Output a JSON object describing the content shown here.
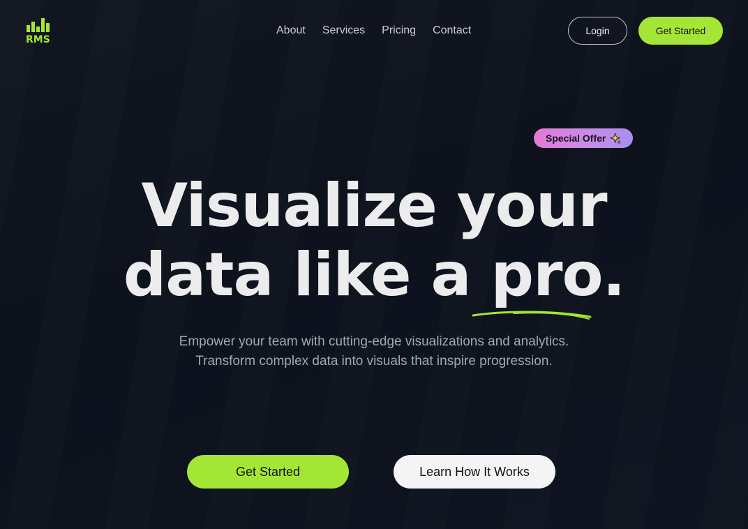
{
  "brand": {
    "logo_text": "RMS",
    "accent": "#a3e635"
  },
  "nav": {
    "items": [
      {
        "label": "About"
      },
      {
        "label": "Services"
      },
      {
        "label": "Pricing"
      },
      {
        "label": "Contact"
      }
    ]
  },
  "header": {
    "login_label": "Login",
    "get_started_label": "Get Started"
  },
  "badge": {
    "label": "Special Offer",
    "icon": "sparkle-icon",
    "gradient": [
      "#e37ad6",
      "#a98ff0"
    ]
  },
  "hero": {
    "line1": "Visualize your",
    "line2": "data like a pro.",
    "subtitle_line1": "Empower your team with cutting-edge visualizations and analytics.",
    "subtitle_line2": "Transform complex data into visuals that inspire progression."
  },
  "cta": {
    "primary_label": "Get Started",
    "secondary_label": "Learn How It Works"
  }
}
